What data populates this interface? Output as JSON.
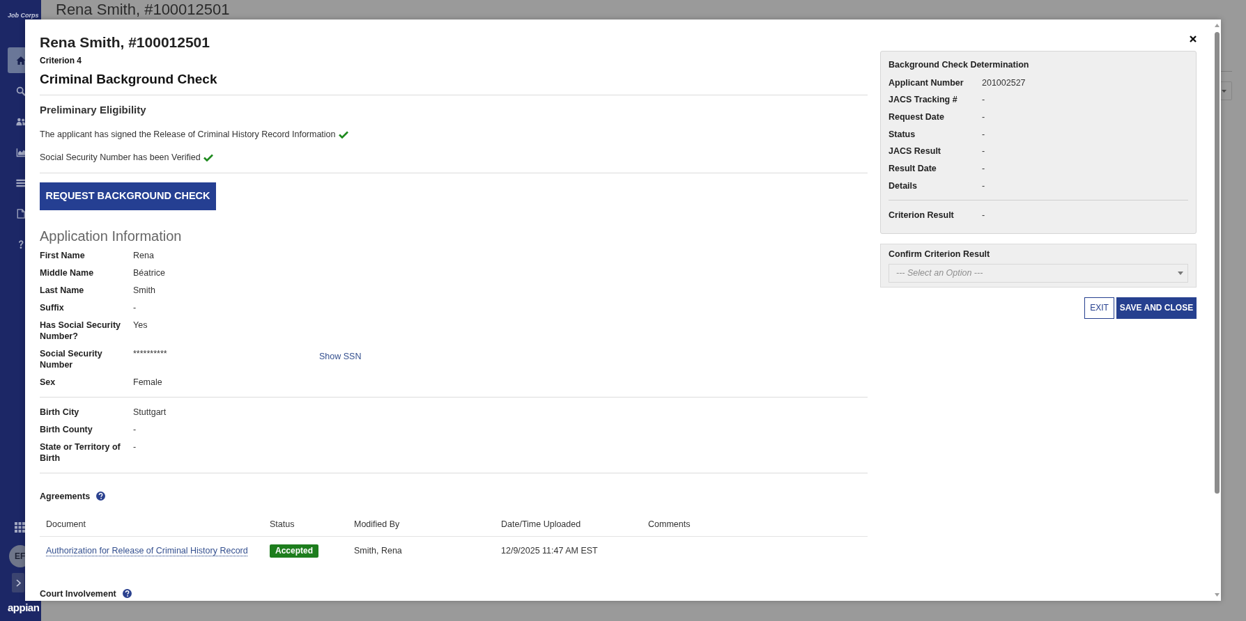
{
  "background_page": {
    "title": "Rena Smith, #100012501"
  },
  "sidebar": {
    "logo": "Job Corps",
    "nav": [
      {
        "selected": true
      },
      {
        "selected": false
      },
      {
        "selected": false
      },
      {
        "selected": false
      },
      {
        "selected": false
      },
      {
        "selected": false
      },
      {
        "selected": false
      }
    ],
    "user_initials": "EF",
    "brand": "appian"
  },
  "modal": {
    "title": "Rena Smith, #100012501",
    "criterion": "Criterion 4",
    "heading": "Criminal Background Check",
    "preliminary": {
      "title": "Preliminary Eligibility",
      "items": [
        {
          "text": "The applicant has signed the Release of Criminal History Record Information",
          "checked": true
        },
        {
          "text": "Social Security Number has been Verified",
          "checked": true
        }
      ]
    },
    "request_button": "REQUEST BACKGROUND CHECK",
    "application": {
      "title": "Application Information",
      "groups": [
        {
          "fields": [
            {
              "label": "First Name",
              "value": "Rena"
            },
            {
              "label": "Middle Name",
              "value": "Béatrice"
            },
            {
              "label": "Last Name",
              "value": "Smith"
            },
            {
              "label": "Suffix",
              "value": "-"
            },
            {
              "label": "Has Social Security Number?",
              "value": "Yes"
            },
            {
              "label": "Social Security Number",
              "value": "**********",
              "link": "Show SSN"
            },
            {
              "label": "Sex",
              "value": "Female"
            }
          ]
        },
        {
          "fields": [
            {
              "label": "Birth City",
              "value": "Stuttgart"
            },
            {
              "label": "Birth County",
              "value": "-"
            },
            {
              "label": "State or Territory of Birth",
              "value": "-"
            }
          ]
        }
      ]
    },
    "agreements": {
      "title": "Agreements",
      "columns": [
        "Document",
        "Status",
        "Modified By",
        "Date/Time Uploaded",
        "Comments"
      ],
      "rows": [
        {
          "document": "Authorization for Release of Criminal History Record",
          "status": "Accepted",
          "modified_by": "Smith, Rena",
          "uploaded": "12/9/2025 11:47 AM EST"
        }
      ]
    },
    "court_involvement": {
      "title": "Court Involvement"
    },
    "determination": {
      "title": "Background Check Determination",
      "fields": [
        {
          "label": "Applicant Number",
          "value": "201002527"
        },
        {
          "label": "JACS Tracking #",
          "value": "-"
        },
        {
          "label": "Request Date",
          "value": "-"
        },
        {
          "label": "Status",
          "value": "-"
        },
        {
          "label": "JACS Result",
          "value": "-"
        },
        {
          "label": "Result Date",
          "value": "-"
        },
        {
          "label": "Details",
          "value": "-"
        }
      ],
      "result": {
        "label": "Criterion Result",
        "value": "-"
      }
    },
    "confirm": {
      "label": "Confirm Criterion Result",
      "placeholder": "--- Select an Option ---"
    },
    "buttons": [
      {
        "label": "EXIT",
        "kind": "secondary"
      },
      {
        "label": "SAVE AND CLOSE",
        "kind": "primary"
      }
    ]
  }
}
